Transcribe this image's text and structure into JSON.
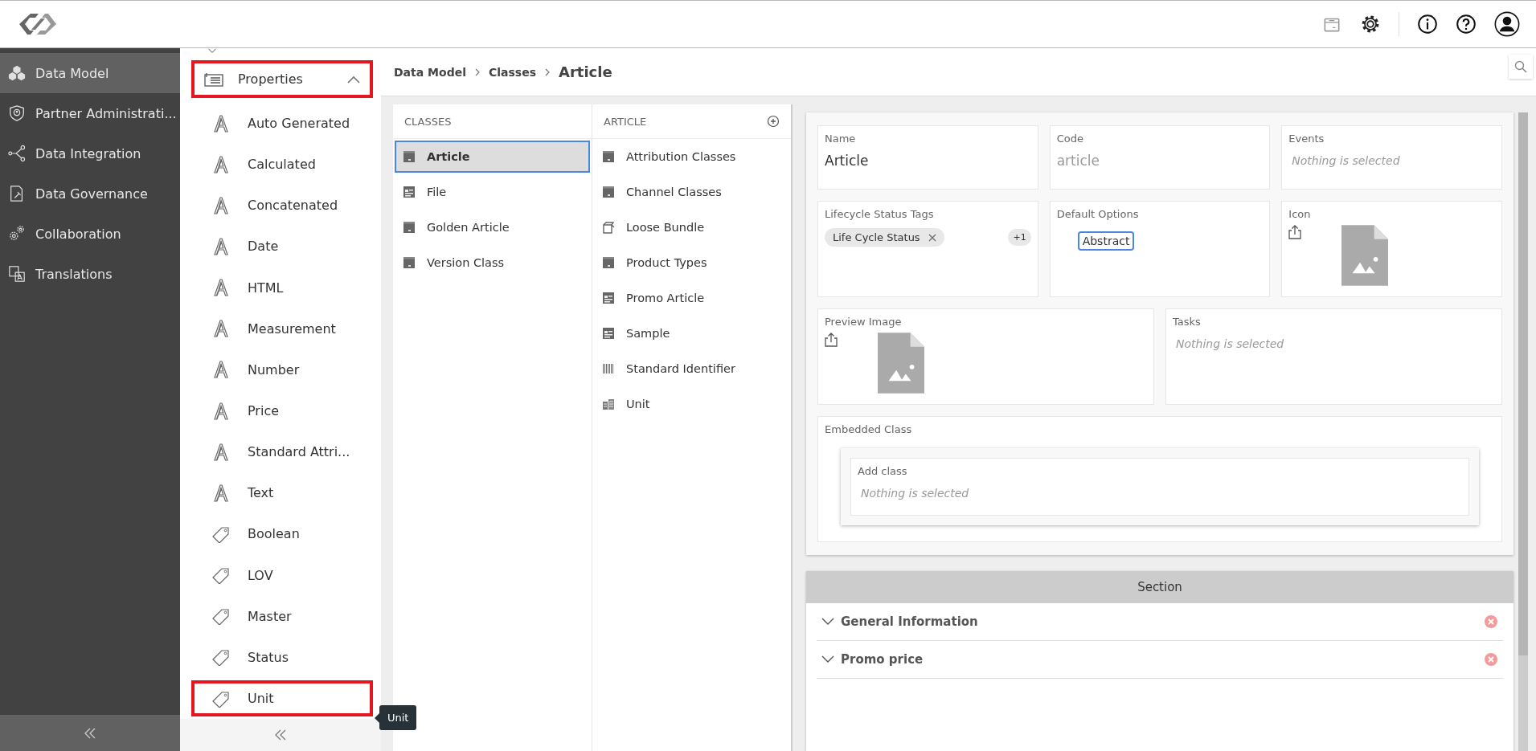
{
  "nav": {
    "items": [
      {
        "label": "Data Model",
        "kind": "cubes",
        "selected": true
      },
      {
        "label": "Partner Administrati...",
        "kind": "shield",
        "selected": false
      },
      {
        "label": "Data Integration",
        "kind": "share",
        "selected": false
      },
      {
        "label": "Data Governance",
        "kind": "audit",
        "selected": false
      },
      {
        "label": "Collaboration",
        "kind": "gears",
        "selected": false
      },
      {
        "label": "Translations",
        "kind": "translate",
        "selected": false
      }
    ]
  },
  "properties": {
    "title": "Properties",
    "expanded": true,
    "highlighted": true,
    "items": [
      {
        "label": "Auto Generated",
        "kind": "attribute",
        "highlighted": false
      },
      {
        "label": "Calculated",
        "kind": "attribute",
        "highlighted": false
      },
      {
        "label": "Concatenated",
        "kind": "attribute",
        "highlighted": false
      },
      {
        "label": "Date",
        "kind": "attribute",
        "highlighted": false
      },
      {
        "label": "HTML",
        "kind": "attribute",
        "highlighted": false
      },
      {
        "label": "Measurement",
        "kind": "attribute",
        "highlighted": false
      },
      {
        "label": "Number",
        "kind": "attribute",
        "highlighted": false
      },
      {
        "label": "Price",
        "kind": "attribute",
        "highlighted": false
      },
      {
        "label": "Standard Attri...",
        "kind": "attribute",
        "highlighted": false
      },
      {
        "label": "Text",
        "kind": "attribute",
        "highlighted": false
      },
      {
        "label": "Boolean",
        "kind": "tag",
        "highlighted": false
      },
      {
        "label": "LOV",
        "kind": "tag",
        "highlighted": false
      },
      {
        "label": "Master",
        "kind": "tag",
        "highlighted": false
      },
      {
        "label": "Status",
        "kind": "tag",
        "highlighted": false
      },
      {
        "label": "Unit",
        "kind": "tag",
        "highlighted": true
      }
    ]
  },
  "tooltip": "Unit",
  "breadcrumb": [
    "Data Model",
    "Classes",
    "Article"
  ],
  "classes": {
    "heading": "CLASSES",
    "items": [
      {
        "label": "Article",
        "kind": "box",
        "selected": true
      },
      {
        "label": "File",
        "kind": "form",
        "selected": false
      },
      {
        "label": "Golden Article",
        "kind": "box",
        "selected": false
      },
      {
        "label": "Version Class",
        "kind": "box",
        "selected": false
      }
    ]
  },
  "article": {
    "heading": "ARTICLE",
    "items": [
      {
        "label": "Attribution Classes",
        "kind": "box"
      },
      {
        "label": "Channel Classes",
        "kind": "box"
      },
      {
        "label": "Loose Bundle",
        "kind": "bundle"
      },
      {
        "label": "Product Types",
        "kind": "box"
      },
      {
        "label": "Promo Article",
        "kind": "form"
      },
      {
        "label": "Sample",
        "kind": "form"
      },
      {
        "label": "Standard Identifier",
        "kind": "barcode"
      },
      {
        "label": "Unit",
        "kind": "unit"
      }
    ]
  },
  "form": {
    "name": {
      "label": "Name",
      "value": "Article"
    },
    "code": {
      "label": "Code",
      "value": "article",
      "disabled": true
    },
    "events": {
      "label": "Events",
      "placeholder": "Nothing is selected"
    },
    "lifecycle": {
      "label": "Lifecycle Status Tags",
      "tags": [
        "Life Cycle Status"
      ],
      "more": "+1"
    },
    "default_options": {
      "label": "Default Options",
      "options": [
        {
          "label": "Abstract",
          "selected": true
        }
      ]
    },
    "icon": {
      "label": "Icon"
    },
    "preview_image": {
      "label": "Preview Image"
    },
    "tasks": {
      "label": "Tasks",
      "placeholder": "Nothing is selected"
    },
    "embedded_class": {
      "label": "Embedded Class",
      "add_label": "Add class",
      "placeholder": "Nothing is selected"
    }
  },
  "sections": {
    "title": "Section",
    "items": [
      {
        "label": "General Information",
        "expanded": false
      },
      {
        "label": "Promo price",
        "expanded": false
      }
    ]
  }
}
